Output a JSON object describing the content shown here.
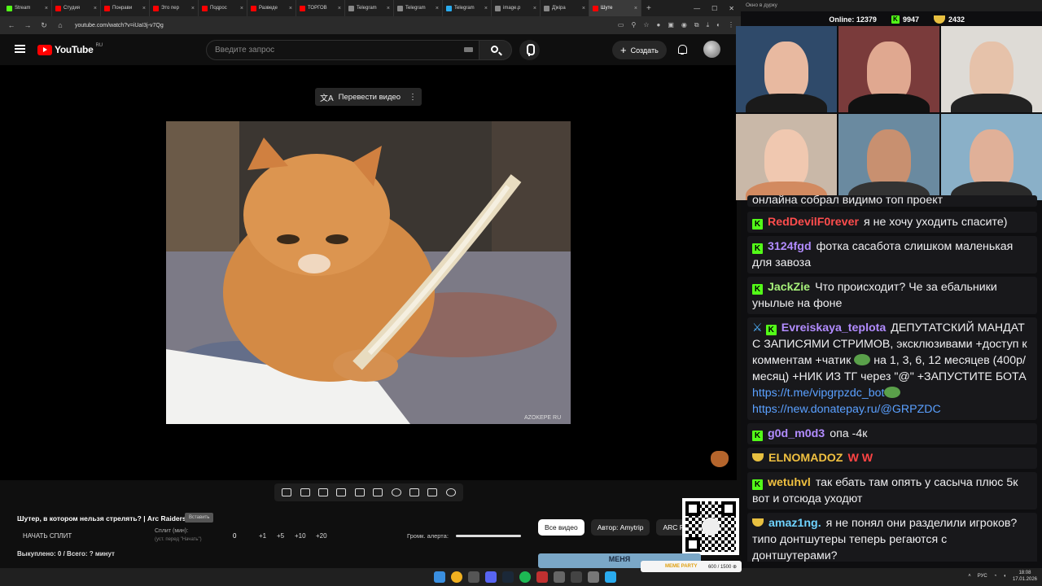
{
  "browser": {
    "tabs": [
      {
        "label": "Stream",
        "color": "#53fc18"
      },
      {
        "label": "Студия",
        "color": "#ff0000"
      },
      {
        "label": "Понрави",
        "color": "#ff0000"
      },
      {
        "label": "Это пер",
        "color": "#ff0000"
      },
      {
        "label": "Подрос",
        "color": "#ff0000"
      },
      {
        "label": "Разведе",
        "color": "#ff0000"
      },
      {
        "label": "ТОРГОВ",
        "color": "#ff0000"
      },
      {
        "label": "Telegram",
        "color": "#888888"
      },
      {
        "label": "Telegram",
        "color": "#888888"
      },
      {
        "label": "Telegram",
        "color": "#2aabee"
      },
      {
        "label": "image.p",
        "color": "#888888"
      },
      {
        "label": "Д)кiра",
        "color": "#888888"
      },
      {
        "label": "Шуте",
        "color": "#ff0000"
      }
    ],
    "url": "youtube.com/watch?v=iUaI3j-v7Qg"
  },
  "youtube": {
    "logo_text": "YouTube",
    "region": "RU",
    "search_placeholder": "Введите запрос",
    "create_label": "Создать"
  },
  "player": {
    "translate_label": "Перевести видео",
    "translate_icon": "translate-icon",
    "watermark": "AZOKEPE RU"
  },
  "video": {
    "title": "Шутер, в котором нельзя стрелять? | Arc Raiders",
    "title_tag": "Вставить",
    "split_button": "НАЧАТЬ СПЛИТ",
    "split_label": "Сплит (мин):",
    "split_sub": "(уст. перед \"Начать\")",
    "split_value": "0",
    "increments": [
      "+1",
      "+5",
      "+10",
      "+20"
    ],
    "volume_label": "Громк. алерта:",
    "volume_level": 1.0,
    "bought": "Выкуплено: 0 / Всего: ? минут"
  },
  "chips": [
    "Все видео",
    "Автор: Amytrip",
    "ARC Ra"
  ],
  "banner": "МЕНЯ",
  "stream": {
    "panel_title": "Окно в дурку",
    "online_label": "Online:",
    "online_count": "12379",
    "kick_count": "9947",
    "emote_count": "2432"
  },
  "chat": [
    {
      "user": "",
      "text": "онлайна собрал видимо топ проект",
      "color": "#efeff1",
      "badge": ""
    },
    {
      "user": "RedDevilF0rever",
      "text": "я не хочу уходить спасите)",
      "color": "#ff4d4d",
      "badge": "kick"
    },
    {
      "user": "3124fgd",
      "text": "фотка сасабота слишком маленькая для завоза",
      "color": "#b28cff",
      "badge": "kick"
    },
    {
      "user": "JackZie",
      "text": "Что происходит? Че за ебальники унылые на фоне",
      "color": "#a6f07a",
      "badge": "kick"
    },
    {
      "user": "Evreiskaya_teplota",
      "text_parts": [
        "ДЕПУТАТСКИЙ МАНДАТ С ЗАПИСЯМИ СТРИМОВ, эксклюзивами +доступ к комментам +чатик",
        "на 1, 3, 6, 12 месяцев (400р/месяц) +НИК ИЗ ТГ через \"@\" +ЗАПУСТИТЕ БОТА"
      ],
      "link1": "https://t.me/vipgrpzdc_bot",
      "link2": "https://new.donatepay.ru/@GRPZDC",
      "color": "#b28cff",
      "badge": "sword-kick"
    },
    {
      "user": "g0d_m0d3",
      "text": "опа -4к",
      "color": "#b28cff",
      "badge": "kick"
    },
    {
      "user": "ELNOMADOZ",
      "text": "W W",
      "color": "#f0c040",
      "badge": "bowl"
    },
    {
      "user": "wetuhvl",
      "text": "так ебать там опять у сасыча плюс 5к вот и отсюда уходют",
      "color": "#f0c040",
      "badge": "kick"
    },
    {
      "user": "amaz1ng.",
      "text": "я не понял они разделили игроков? типо донтшутеры теперь регаются с донтшутерами?",
      "color": "#6fd3ff",
      "badge": "bowl"
    }
  ],
  "taskbar": {
    "time": "18:08",
    "date": "17.01.2026",
    "lang": "РУС",
    "meme_label": "MEME PARTY",
    "meme_progress": "600 / 1500 ⊕"
  }
}
